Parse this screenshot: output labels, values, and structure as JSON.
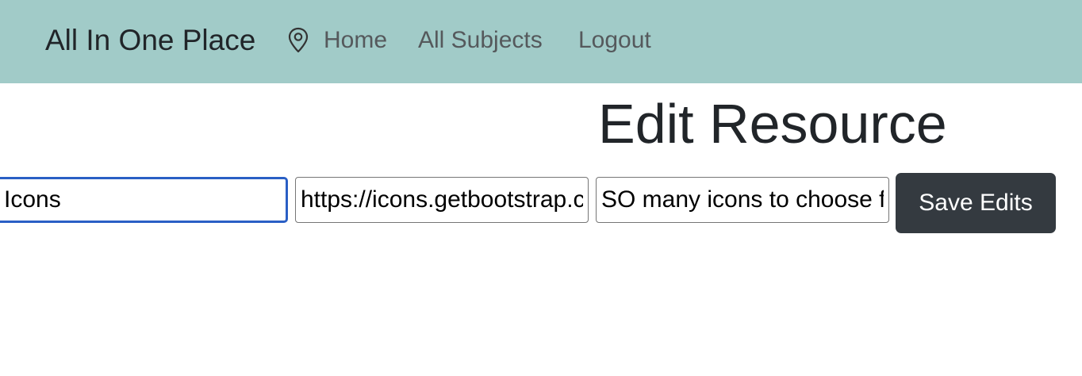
{
  "navbar": {
    "brand": "All In One Place",
    "links": [
      {
        "label": "Home",
        "icon": "map-pin-icon"
      },
      {
        "label": "All Subjects"
      },
      {
        "label": "Logout"
      }
    ],
    "background_color": "#a1cbc8"
  },
  "main": {
    "title": "Edit Resource",
    "form": {
      "title_value": "Icons",
      "url_value": "https://icons.getbootstrap.com",
      "description_value": "SO many icons to choose from",
      "save_label": "Save Edits"
    }
  },
  "colors": {
    "button": "#343a40",
    "focus_border": "#2a5fc5"
  }
}
